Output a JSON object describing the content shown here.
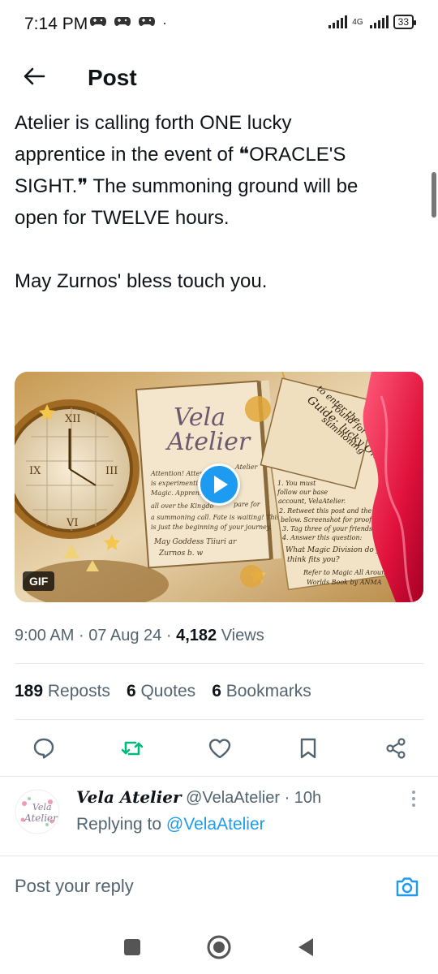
{
  "status_bar": {
    "time": "7:14 PM",
    "notification_icons": [
      "game-controller-icon",
      "game-controller-icon",
      "game-controller-icon"
    ],
    "dot": "·",
    "network": "4G",
    "battery": "33"
  },
  "header": {
    "title": "Post",
    "back_icon": "back-arrow-icon"
  },
  "post": {
    "text": "Atelier is calling forth ONE lucky\napprentice in the event of ❝ORACLE'S\nSIGHT.❞ The summoning ground will be\nopen for TWELVE hours.\n\nMay Zurnos' bless touch you.",
    "media": {
      "badge": "GIF",
      "left_page": {
        "logo_line1": "Vela",
        "logo_line2": "Atelier",
        "body": [
          "Attention! Attention",
          "is experimenting",
          "Magic. Apprenti",
          "all over the Kingdo",
          "a summoning call. Fate is waiting! This",
          "is just the beginning of your journey.",
          "May Goddess Tiiuri ar",
          "Zurnos b. w"
        ],
        "side": [
          "Atelier",
          "pare for"
        ]
      },
      "right_page": {
        "lines": [
          "1. You must",
          "follow our base",
          "account, VelaAtelier.",
          "2. Retweet this post and the teaser",
          "below. Screenshot for proof!",
          "3. Tag three of your friends.",
          "4. Answer this question:",
          "What Magic Division do you",
          "think fits you?",
          "Refer to Magic All Around",
          "Worlds Book by ANMA"
        ]
      },
      "scroll": {
        "lines": [
          "Guide:",
          "to enter the",
          "summoning",
          "round for the",
          "lucky One!"
        ]
      }
    },
    "meta": {
      "time": "9:00 AM",
      "sep": "·",
      "date": "07 Aug 24",
      "views_count": "4,182",
      "views_label": "Views"
    },
    "stats": [
      {
        "count": "189",
        "label": "Reposts"
      },
      {
        "count": "6",
        "label": "Quotes"
      },
      {
        "count": "6",
        "label": "Bookmarks"
      }
    ],
    "actions": {
      "reply_icon": "reply-icon",
      "repost_icon": "repost-icon",
      "like_icon": "heart-icon",
      "bookmark_icon": "bookmark-icon",
      "share_icon": "share-icon",
      "repost_color": "#00ba7c",
      "icon_color": "#536471"
    }
  },
  "reply": {
    "display_name": "Vela Atelier",
    "handle": "@VelaAtelier",
    "sep": "·",
    "time": "10h",
    "replying_prefix": "Replying to",
    "replying_handle": "@VelaAtelier",
    "avatar_text_1": "Vela",
    "avatar_text_2": "Atelier"
  },
  "composer": {
    "placeholder": "Post your reply",
    "camera_icon": "camera-icon",
    "accent": "#1d9bf0"
  },
  "nav": {
    "recents_icon": "square-icon",
    "home_icon": "circle-home-icon",
    "back_icon": "triangle-back-icon"
  }
}
